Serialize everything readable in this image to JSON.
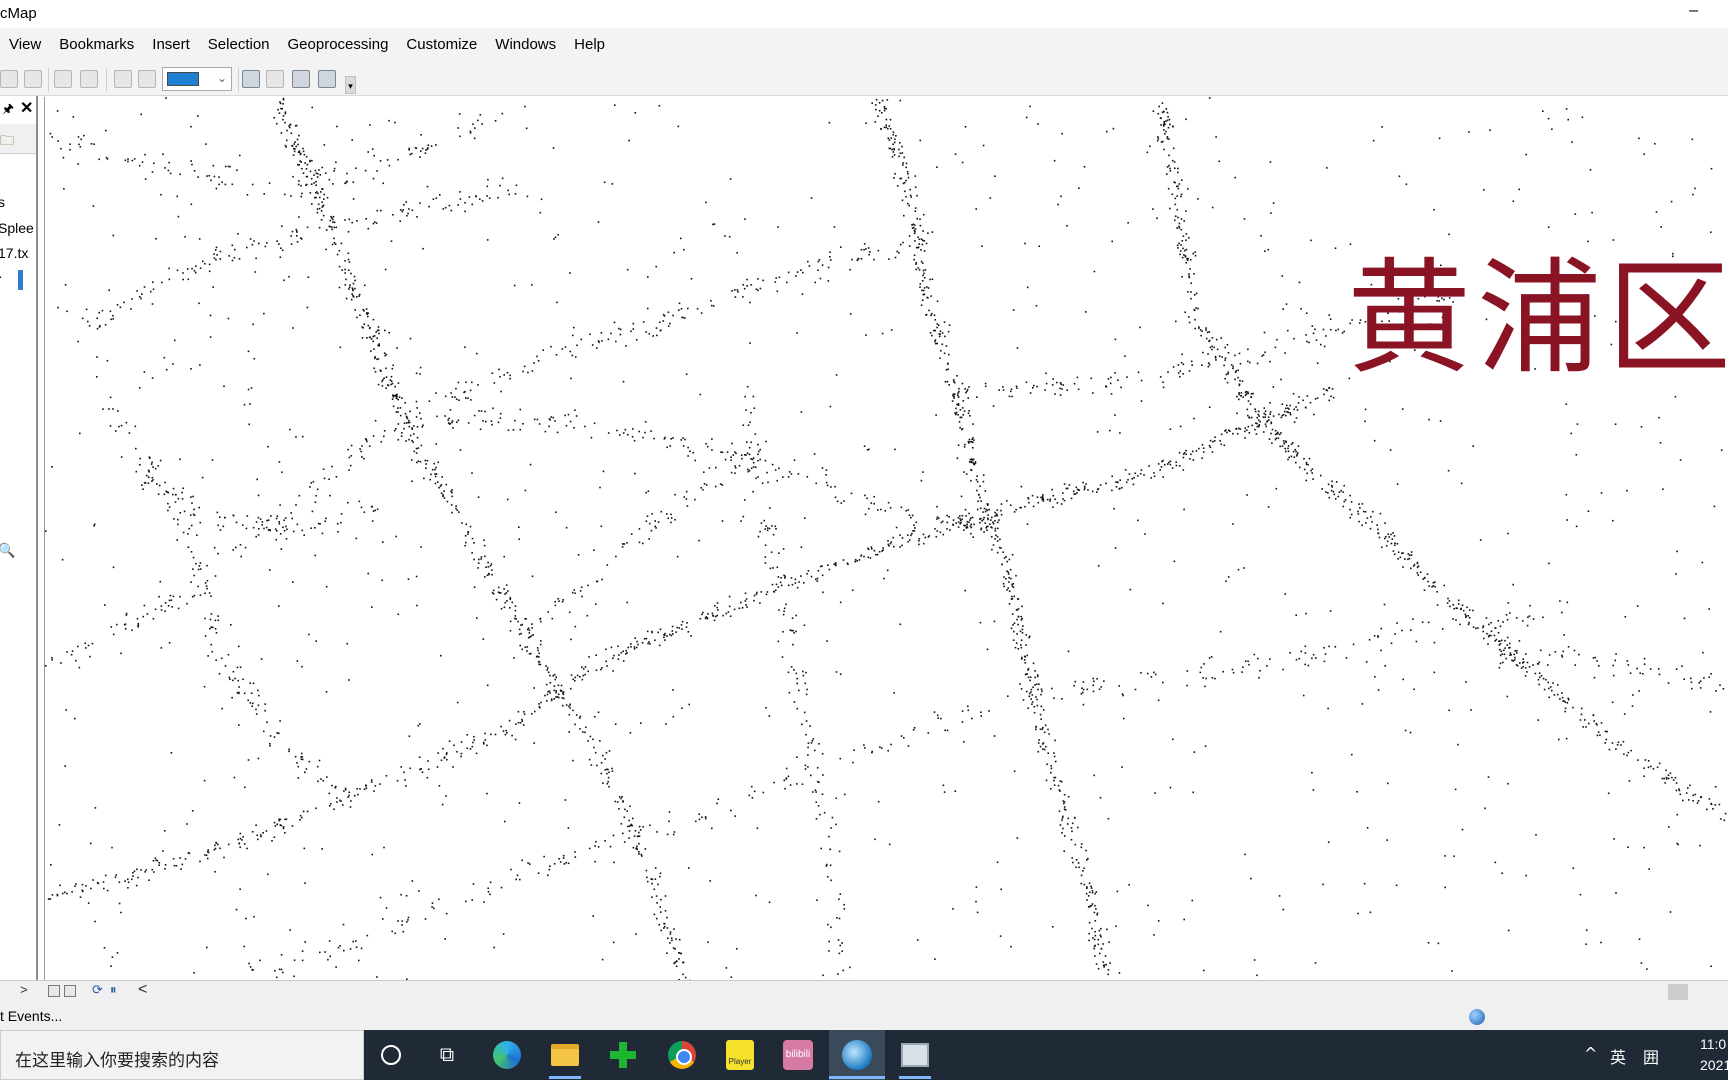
{
  "window": {
    "title": "cMap",
    "minimize_glyph": "–"
  },
  "menu": [
    "View",
    "Bookmarks",
    "Insert",
    "Selection",
    "Geoprocessing",
    "Customize",
    "Windows",
    "Help"
  ],
  "toolbar": {
    "color_combo_color": "#1f7fd1",
    "overflow_glyph": "▾"
  },
  "toc": {
    "pin_glyph": "📌",
    "close_glyph": "✕",
    "layer_labels": [
      "s",
      "Splee",
      "17.tx",
      "·"
    ]
  },
  "map": {
    "label": "黄浦区",
    "label_color": "#8a1324",
    "point_color": "#111111"
  },
  "mapbar": {
    "scroll_left": "<",
    "scroll_right": ">"
  },
  "status": {
    "text": "t Events..."
  },
  "taskbar": {
    "search_placeholder": "在这里输入你要搜索的内容",
    "player_label": "Player",
    "bili_label": "bilibili",
    "tray": {
      "caret": "^",
      "ime": "英",
      "grid": "囲"
    },
    "clock": {
      "time": "11:0",
      "date": "2021/"
    }
  }
}
